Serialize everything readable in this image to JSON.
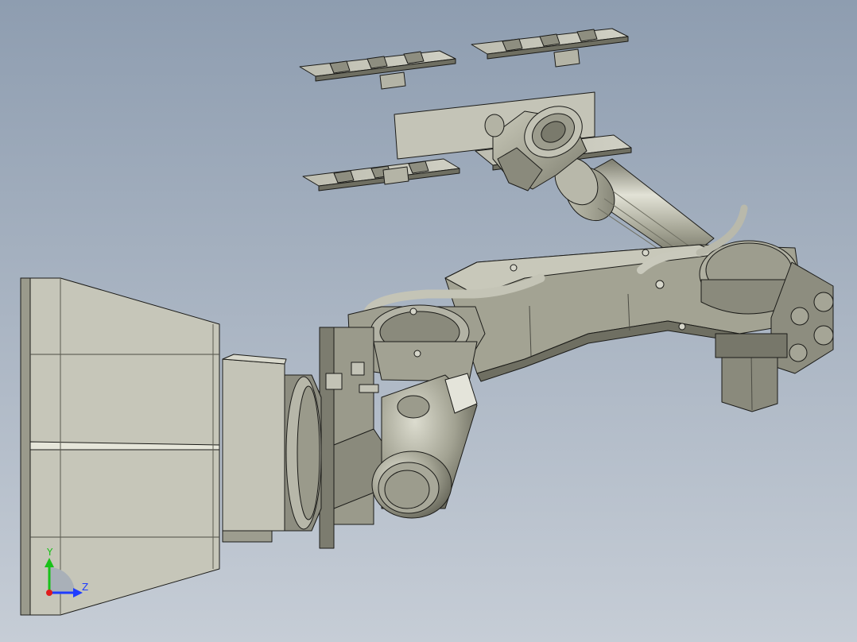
{
  "view": {
    "background_top": "#8e9db0",
    "background_bottom": "#c6cdd6",
    "part_fill": "#a9a999",
    "part_light": "#d2d2c4",
    "part_dark": "#6f6f62",
    "edge_color": "#1b1b18"
  },
  "triad": {
    "y_label": "Y",
    "z_label": "Z",
    "y_color": "#19c119",
    "z_color": "#1f3cff",
    "x_color": "#e01c1c"
  }
}
